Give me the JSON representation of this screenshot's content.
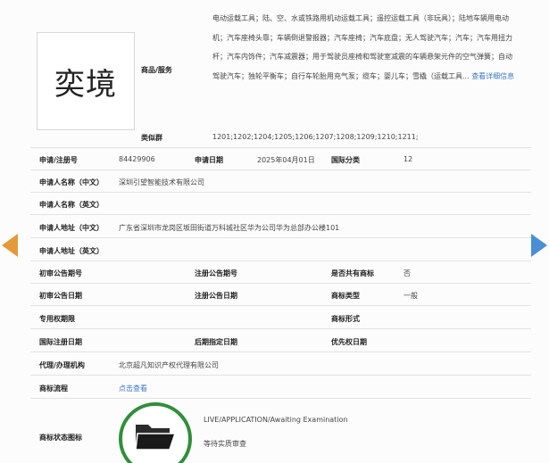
{
  "trademark": {
    "logo_text": "奕境",
    "goods_label": "商品/服务",
    "goods_text": "电动运载工具；陆、空、水或铁路用机动运载工具；遥控运载工具（非玩具）；陆地车辆用电动机；汽车座椅头靠；车辆倒退警报器；汽车座椅；汽车底盘；无人驾驶汽车；汽车；汽车用扭力杆；汽车内饰件；汽车减震器；用于驾驶员座椅和驾驶室减震的车辆悬架元件的空气弹簧；自动驾驶汽车；独轮平衡车；自行车轮胎用充气泵；缆车；婴儿车；雪橇（运载工具...",
    "goods_more": "查看详细信息",
    "similar_group_label": "类似群",
    "similar_group_value": "1201;1202;1204;1205;1206;1207;1208;1209;1210;1211;",
    "reg_no_label": "申请/注册号",
    "reg_no_value": "84429906",
    "apply_date_label": "申请日期",
    "apply_date_value": "2025年04月01日",
    "intl_class_label": "国际分类",
    "intl_class_value": "12",
    "applicant_cn_label": "申请人名称（中文）",
    "applicant_cn_value": "深圳引望智能技术有限公司",
    "applicant_en_label": "申请人名称（英文）",
    "applicant_en_value": "",
    "address_cn_label": "申请人地址（中文）",
    "address_cn_value": "广东省深圳市龙岗区坂田街道万科城社区华为公司华为总部办公楼101",
    "address_en_label": "申请人地址（英文）",
    "address_en_value": "",
    "prelim_no_label": "初审公告期号",
    "reg_pub_no_label": "注册公告期号",
    "shared_label": "是否共有商标",
    "shared_value": "否",
    "prelim_date_label": "初审公告日期",
    "reg_pub_date_label": "注册公告日期",
    "tm_type_label": "商标类型",
    "tm_type_value": "一般",
    "exclusive_label": "专用权期限",
    "tm_form_label": "商标形式",
    "intl_reg_date_label": "国际注册日期",
    "later_date_label": "后期指定日期",
    "priority_date_label": "优先权日期",
    "agent_label": "代理/办理机构",
    "agent_value": "北京超凡知识产权代理有限公司",
    "process_label": "商标流程",
    "process_link": "点击查看",
    "status_icon_label": "商标状态图标",
    "status_en": "LIVE/APPLICATION/Awaiting Examination",
    "status_cn": "等待实质审查"
  },
  "colors": {
    "link": "#3a79c7",
    "status_ring": "#2f8f3a",
    "arrow_left": "#e39a3a",
    "arrow_right": "#4a8fd6"
  }
}
